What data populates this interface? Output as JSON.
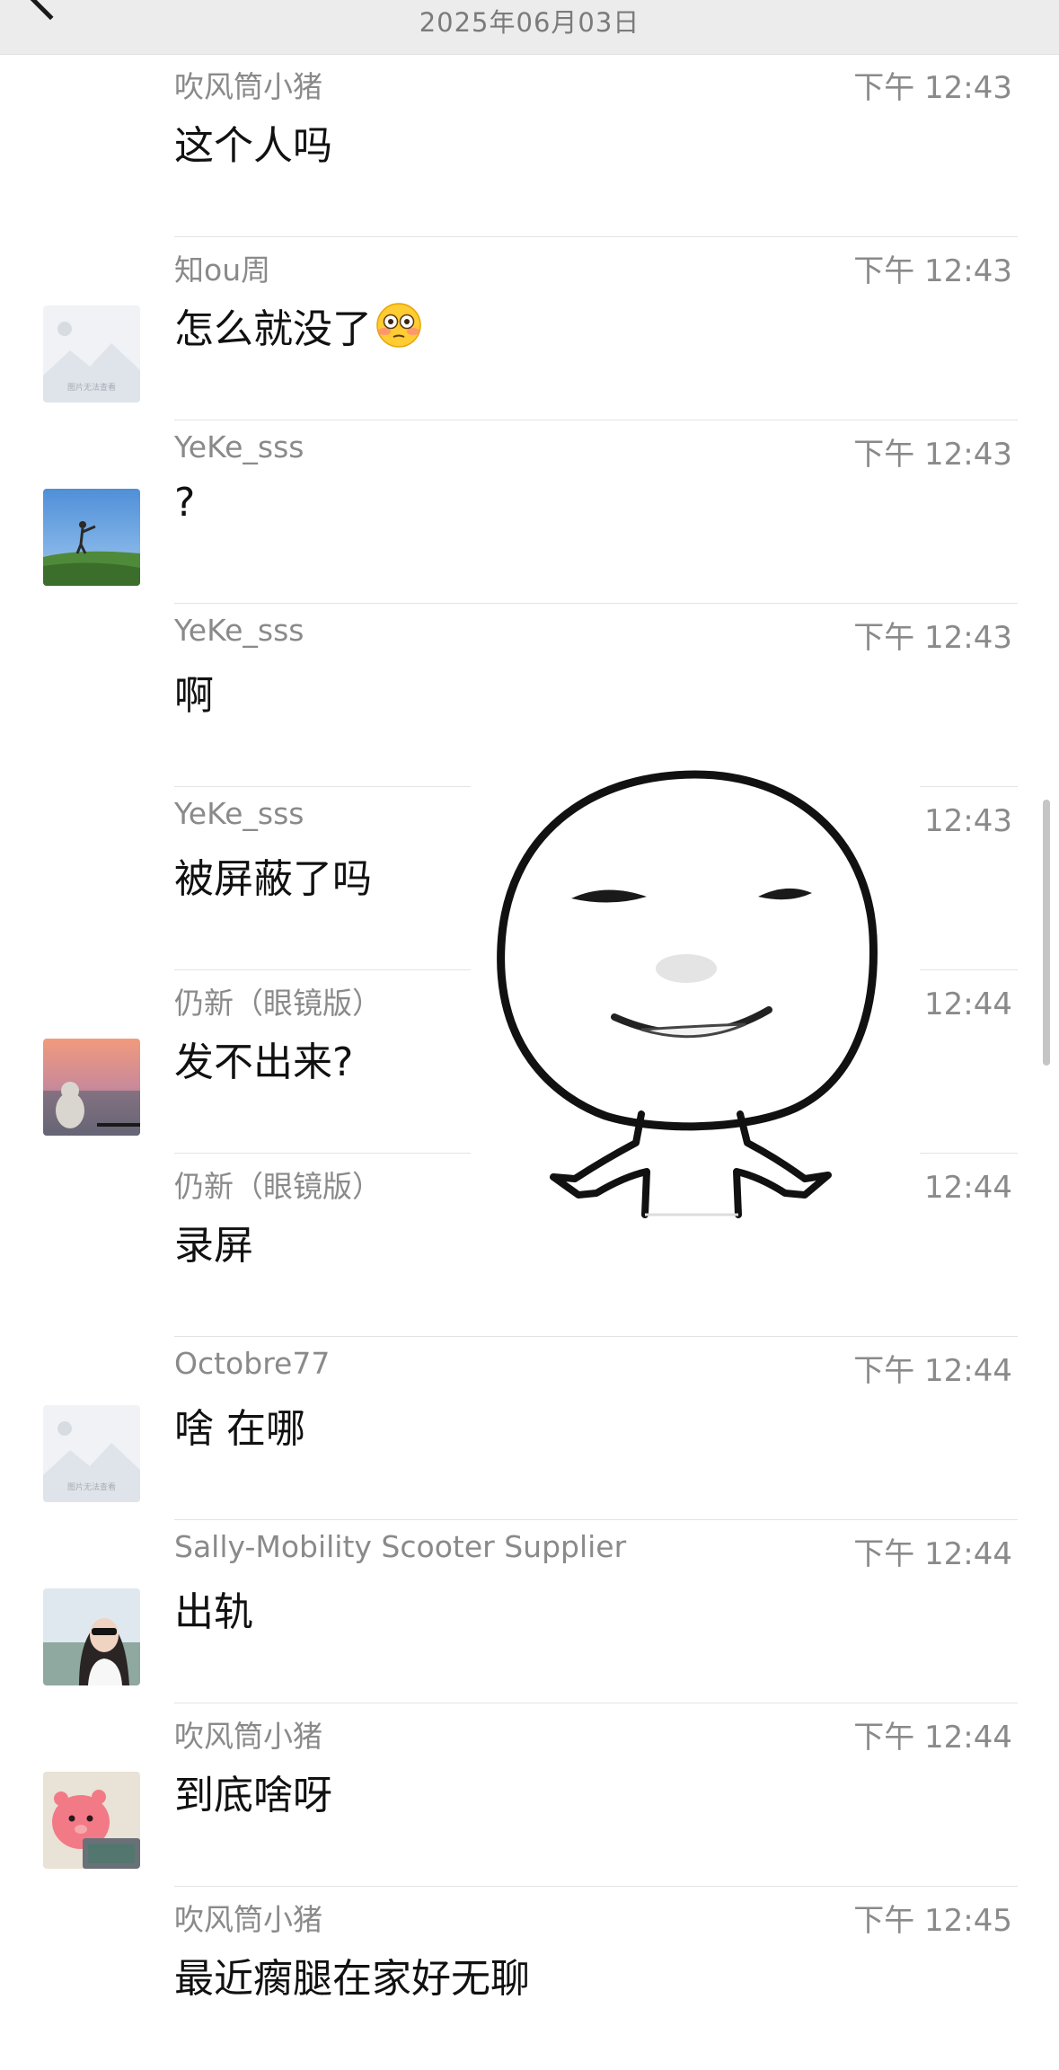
{
  "header": {
    "date": "2025年06月03日"
  },
  "messages": [
    {
      "sender": "吹风筒小猪",
      "time": "下午 12:43",
      "text": "这个人吗",
      "avatar": "none"
    },
    {
      "sender": "知ou周",
      "time": "下午 12:43",
      "text": "怎么就没了",
      "emoji": "flushed-face-emoji",
      "avatar": "image-unavailable"
    },
    {
      "sender": "YeKe_sss",
      "time": "下午 12:43",
      "text": "?",
      "avatar": "photo-sky-grass"
    },
    {
      "sender": "YeKe_sss",
      "time": "下午 12:43",
      "text": "啊",
      "avatar": "none"
    },
    {
      "sender": "YeKe_sss",
      "time": "下午 12:43",
      "text": "被屏蔽了吗",
      "avatar": "none"
    },
    {
      "sender": "仍新（眼镜版）",
      "time": "下午 12:44",
      "text": "发不出来?",
      "avatar": "photo-sunset"
    },
    {
      "sender": "仍新（眼镜版）",
      "time": "下午 12:44",
      "text": "录屏",
      "avatar": "none"
    },
    {
      "sender": "Octobre77",
      "time": "下午 12:44",
      "text": "啥 在哪",
      "avatar": "image-unavailable"
    },
    {
      "sender": "Sally-Mobility Scooter Supplier",
      "time": "下午 12:44",
      "text": "出轨",
      "avatar": "photo-woman"
    },
    {
      "sender": "吹风筒小猪",
      "time": "下午 12:44",
      "text": "到底啥呀",
      "avatar": "photo-pink-plush"
    },
    {
      "sender": "吹风筒小猪",
      "time": "下午 12:45",
      "text": "最近瘸腿在家好无聊",
      "avatar": "none"
    }
  ],
  "avatar_placeholder_text": "图片无法查看",
  "sticker": {
    "name": "smiling-bald-head-meme-sticker"
  },
  "colors": {
    "header_bg": "#ececec",
    "secondary_text": "#8a8a8a",
    "primary_text": "#111111",
    "divider": "#e3e3e3"
  }
}
